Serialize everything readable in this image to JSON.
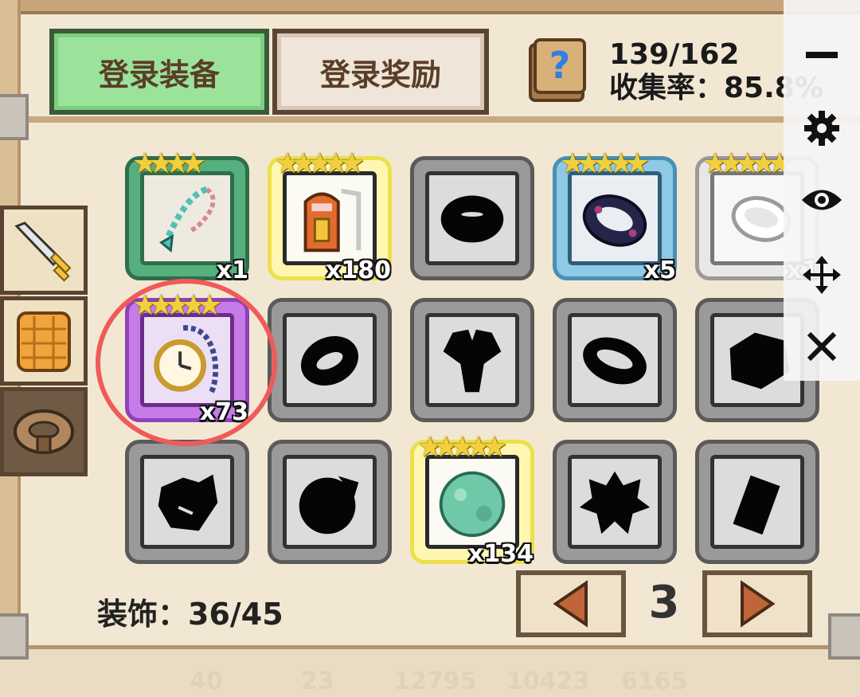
{
  "tabs": {
    "equip_label": "登录装备",
    "reward_label": "登录奖励"
  },
  "collection": {
    "count": "139/162",
    "rate": "收集率：85.8%"
  },
  "side_tabs": [
    "weapon",
    "armor",
    "accessory"
  ],
  "slots": [
    {
      "quality": "green",
      "stars": 4,
      "count": "x1",
      "item": "necklace-icon"
    },
    {
      "quality": "yellow",
      "stars": 5,
      "count": "x180",
      "item": "chest-icon"
    },
    {
      "quality": "unknown",
      "stars": 0,
      "count": "",
      "item": "silhouette"
    },
    {
      "quality": "blue",
      "stars": 5,
      "count": "x5",
      "item": "dark-ring-icon"
    },
    {
      "quality": "white",
      "stars": 5,
      "count": "x1",
      "item": "white-ring-icon"
    },
    {
      "quality": "purple",
      "stars": 5,
      "count": "x73",
      "item": "pocket-watch-icon"
    },
    {
      "quality": "unknown",
      "stars": 0,
      "count": "",
      "item": "silhouette"
    },
    {
      "quality": "unknown",
      "stars": 0,
      "count": "",
      "item": "silhouette"
    },
    {
      "quality": "unknown",
      "stars": 0,
      "count": "",
      "item": "silhouette"
    },
    {
      "quality": "unknown",
      "stars": 0,
      "count": "",
      "item": "silhouette"
    },
    {
      "quality": "unknown",
      "stars": 0,
      "count": "",
      "item": "silhouette"
    },
    {
      "quality": "unknown",
      "stars": 0,
      "count": "",
      "item": "silhouette"
    },
    {
      "quality": "yellow",
      "stars": 5,
      "count": "x134",
      "item": "green-orb-icon"
    },
    {
      "quality": "unknown",
      "stars": 0,
      "count": "",
      "item": "silhouette"
    },
    {
      "quality": "unknown",
      "stars": 0,
      "count": "",
      "item": "silhouette"
    }
  ],
  "footer": {
    "deco_label": "装饰：36/45",
    "page": "3"
  },
  "bottom_faint": [
    "40",
    "23",
    "12795",
    "10423",
    "6165"
  ],
  "colors": {
    "active_tab": "#9be39b",
    "highlight": "#f05a5a",
    "frame": "#c7a57a"
  }
}
